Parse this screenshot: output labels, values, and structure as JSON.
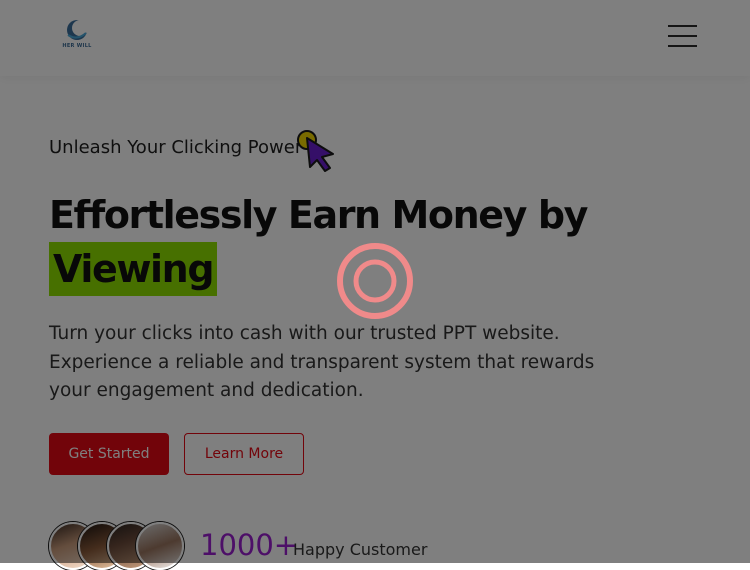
{
  "header": {
    "logo_text": "HER WILL",
    "menu_icon": "hamburger-menu-icon"
  },
  "hero": {
    "tagline": "Unleash Your Clicking Power",
    "headline_line1": "Effortlessly Earn Money by",
    "headline_highlight": "Viewing",
    "description": "Turn your clicks into cash with our trusted PPT website. Experience a reliable and transparent system that rewards your engagement and dedication.",
    "primary_button": "Get Started",
    "secondary_button": "Learn More"
  },
  "stats": {
    "number": "1000+",
    "label": "Happy Customer"
  },
  "colors": {
    "accent_red": "#e50914",
    "highlight_green": "#8ee000",
    "stat_purple": "#9b1fd1"
  }
}
